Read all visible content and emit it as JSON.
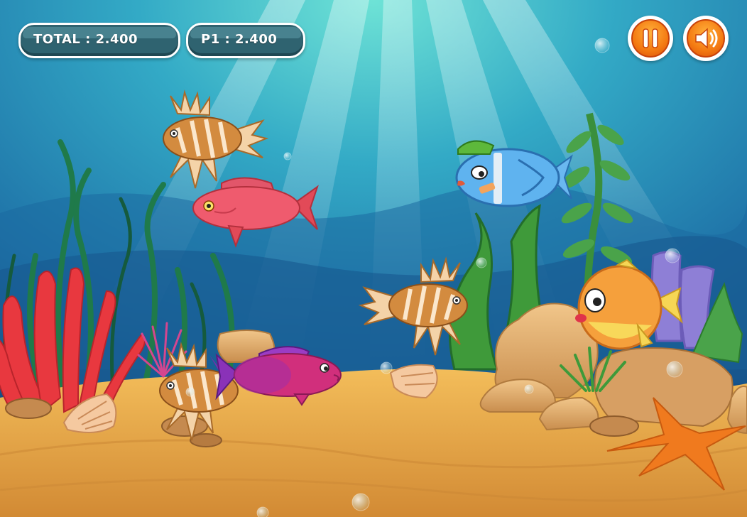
{
  "hud": {
    "total_label": "TOTAL : 2.400",
    "player_label": "P1 : 2.400"
  },
  "controls": {
    "pause_icon": "pause-icon",
    "sound_icon": "speaker-icon"
  },
  "colors": {
    "water_top": "#5fd6d2",
    "water_mid": "#2a9bc0",
    "water_deep": "#1a5f95",
    "sand": "#e9a94a",
    "button_orange": "#f47a12",
    "hud_pill": "#2f6370"
  },
  "fish": [
    {
      "kind": "lionfish"
    },
    {
      "kind": "red-snapper"
    },
    {
      "kind": "blue-tang"
    },
    {
      "kind": "lionfish"
    },
    {
      "kind": "pufferfish"
    },
    {
      "kind": "lionfish"
    },
    {
      "kind": "grouper"
    }
  ]
}
